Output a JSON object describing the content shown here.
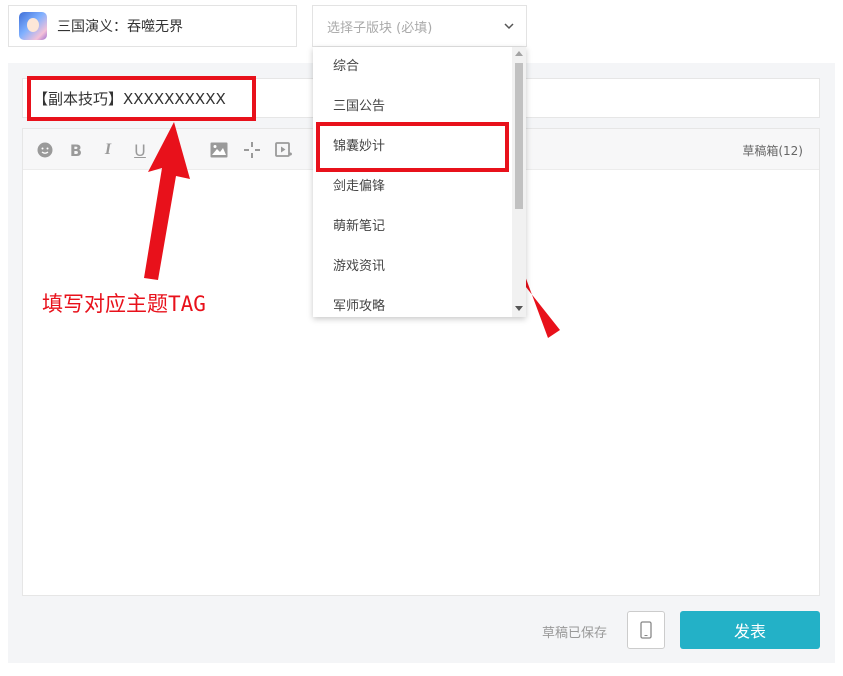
{
  "header": {
    "game_name": "三国演义：吞噬无界",
    "subforum_placeholder": "选择子版块 (必填)"
  },
  "title_input": {
    "value": "【副本技巧】XXXXXXXXXX"
  },
  "toolbar": {
    "icons": [
      "emoji-icon",
      "bold-icon",
      "italic-icon",
      "underline-icon",
      "image-icon",
      "sparkle-icon",
      "video-icon"
    ],
    "draft_box_label": "草稿箱(12)"
  },
  "dropdown": {
    "items": [
      "综合",
      "三国公告",
      "锦囊妙计",
      "剑走偏锋",
      "萌新笔记",
      "游戏资讯",
      "军师攻略"
    ],
    "highlighted_item": "锦囊妙计"
  },
  "annotation": {
    "text": "填写对应主题TAG",
    "color": "#e8111b"
  },
  "footer": {
    "saved_status": "草稿已保存",
    "publish_label": "发表",
    "publish_color": "#23b1c7"
  }
}
